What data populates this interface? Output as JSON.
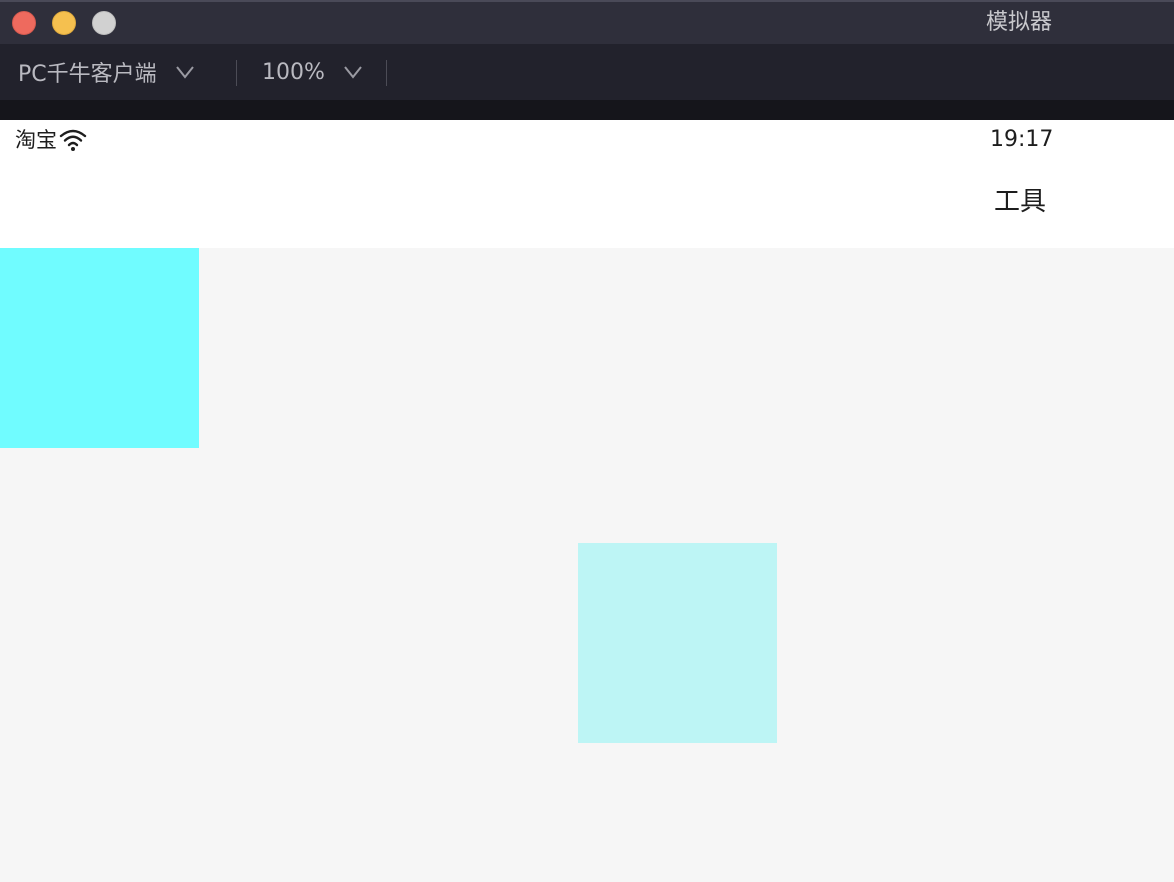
{
  "window": {
    "title": "模拟器"
  },
  "toolbar": {
    "device_label": "PC千牛客户端",
    "zoom_label": "100%"
  },
  "statusbar": {
    "carrier": "淘宝",
    "time": "19:17"
  },
  "navbar": {
    "title": "工具"
  },
  "content": {
    "boxes": [
      {
        "name": "cyan-box",
        "color": "#70fcff"
      },
      {
        "name": "light-cyan-box",
        "color": "#bdf5f5"
      }
    ]
  },
  "colors": {
    "close": "#ee6a5e",
    "minimize": "#f5c04f",
    "zoom": "#d1d1d1"
  }
}
